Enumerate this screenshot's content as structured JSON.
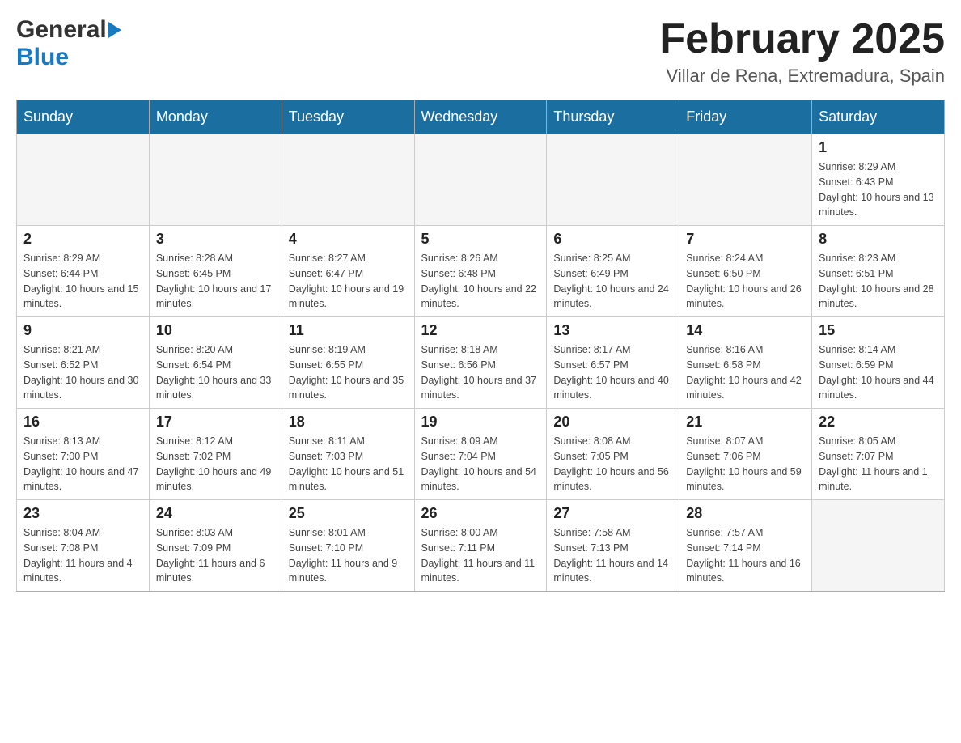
{
  "logo": {
    "general": "General",
    "blue": "Blue"
  },
  "title": "February 2025",
  "location": "Villar de Rena, Extremadura, Spain",
  "weekdays": [
    "Sunday",
    "Monday",
    "Tuesday",
    "Wednesday",
    "Thursday",
    "Friday",
    "Saturday"
  ],
  "weeks": [
    [
      {
        "day": "",
        "info": ""
      },
      {
        "day": "",
        "info": ""
      },
      {
        "day": "",
        "info": ""
      },
      {
        "day": "",
        "info": ""
      },
      {
        "day": "",
        "info": ""
      },
      {
        "day": "",
        "info": ""
      },
      {
        "day": "1",
        "info": "Sunrise: 8:29 AM\nSunset: 6:43 PM\nDaylight: 10 hours and 13 minutes."
      }
    ],
    [
      {
        "day": "2",
        "info": "Sunrise: 8:29 AM\nSunset: 6:44 PM\nDaylight: 10 hours and 15 minutes."
      },
      {
        "day": "3",
        "info": "Sunrise: 8:28 AM\nSunset: 6:45 PM\nDaylight: 10 hours and 17 minutes."
      },
      {
        "day": "4",
        "info": "Sunrise: 8:27 AM\nSunset: 6:47 PM\nDaylight: 10 hours and 19 minutes."
      },
      {
        "day": "5",
        "info": "Sunrise: 8:26 AM\nSunset: 6:48 PM\nDaylight: 10 hours and 22 minutes."
      },
      {
        "day": "6",
        "info": "Sunrise: 8:25 AM\nSunset: 6:49 PM\nDaylight: 10 hours and 24 minutes."
      },
      {
        "day": "7",
        "info": "Sunrise: 8:24 AM\nSunset: 6:50 PM\nDaylight: 10 hours and 26 minutes."
      },
      {
        "day": "8",
        "info": "Sunrise: 8:23 AM\nSunset: 6:51 PM\nDaylight: 10 hours and 28 minutes."
      }
    ],
    [
      {
        "day": "9",
        "info": "Sunrise: 8:21 AM\nSunset: 6:52 PM\nDaylight: 10 hours and 30 minutes."
      },
      {
        "day": "10",
        "info": "Sunrise: 8:20 AM\nSunset: 6:54 PM\nDaylight: 10 hours and 33 minutes."
      },
      {
        "day": "11",
        "info": "Sunrise: 8:19 AM\nSunset: 6:55 PM\nDaylight: 10 hours and 35 minutes."
      },
      {
        "day": "12",
        "info": "Sunrise: 8:18 AM\nSunset: 6:56 PM\nDaylight: 10 hours and 37 minutes."
      },
      {
        "day": "13",
        "info": "Sunrise: 8:17 AM\nSunset: 6:57 PM\nDaylight: 10 hours and 40 minutes."
      },
      {
        "day": "14",
        "info": "Sunrise: 8:16 AM\nSunset: 6:58 PM\nDaylight: 10 hours and 42 minutes."
      },
      {
        "day": "15",
        "info": "Sunrise: 8:14 AM\nSunset: 6:59 PM\nDaylight: 10 hours and 44 minutes."
      }
    ],
    [
      {
        "day": "16",
        "info": "Sunrise: 8:13 AM\nSunset: 7:00 PM\nDaylight: 10 hours and 47 minutes."
      },
      {
        "day": "17",
        "info": "Sunrise: 8:12 AM\nSunset: 7:02 PM\nDaylight: 10 hours and 49 minutes."
      },
      {
        "day": "18",
        "info": "Sunrise: 8:11 AM\nSunset: 7:03 PM\nDaylight: 10 hours and 51 minutes."
      },
      {
        "day": "19",
        "info": "Sunrise: 8:09 AM\nSunset: 7:04 PM\nDaylight: 10 hours and 54 minutes."
      },
      {
        "day": "20",
        "info": "Sunrise: 8:08 AM\nSunset: 7:05 PM\nDaylight: 10 hours and 56 minutes."
      },
      {
        "day": "21",
        "info": "Sunrise: 8:07 AM\nSunset: 7:06 PM\nDaylight: 10 hours and 59 minutes."
      },
      {
        "day": "22",
        "info": "Sunrise: 8:05 AM\nSunset: 7:07 PM\nDaylight: 11 hours and 1 minute."
      }
    ],
    [
      {
        "day": "23",
        "info": "Sunrise: 8:04 AM\nSunset: 7:08 PM\nDaylight: 11 hours and 4 minutes."
      },
      {
        "day": "24",
        "info": "Sunrise: 8:03 AM\nSunset: 7:09 PM\nDaylight: 11 hours and 6 minutes."
      },
      {
        "day": "25",
        "info": "Sunrise: 8:01 AM\nSunset: 7:10 PM\nDaylight: 11 hours and 9 minutes."
      },
      {
        "day": "26",
        "info": "Sunrise: 8:00 AM\nSunset: 7:11 PM\nDaylight: 11 hours and 11 minutes."
      },
      {
        "day": "27",
        "info": "Sunrise: 7:58 AM\nSunset: 7:13 PM\nDaylight: 11 hours and 14 minutes."
      },
      {
        "day": "28",
        "info": "Sunrise: 7:57 AM\nSunset: 7:14 PM\nDaylight: 11 hours and 16 minutes."
      },
      {
        "day": "",
        "info": ""
      }
    ]
  ]
}
